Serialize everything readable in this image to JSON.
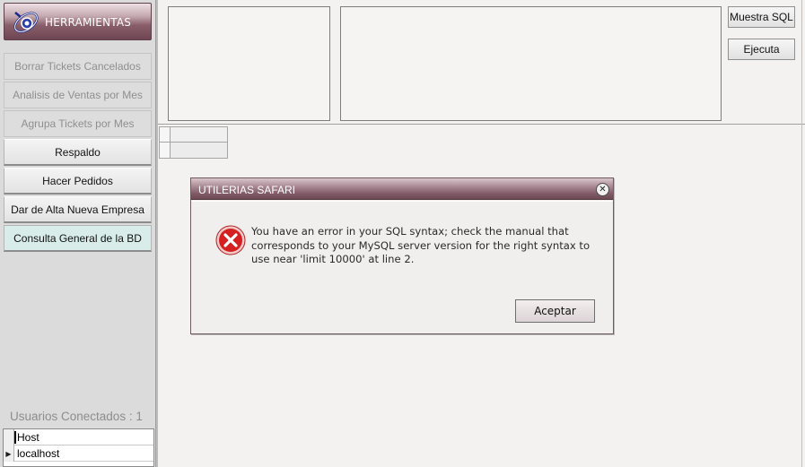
{
  "sidebar": {
    "title": "HERRAMIENTAS",
    "logo_icon": "satellite-logo-icon",
    "items": [
      {
        "label": "Borrar Tickets Cancelados",
        "state": "disabled"
      },
      {
        "label": "Analisis de Ventas por Mes",
        "state": "disabled"
      },
      {
        "label": "Agrupa Tickets por Mes",
        "state": "disabled"
      },
      {
        "label": "Respaldo",
        "state": "enabled"
      },
      {
        "label": "Hacer Pedidos",
        "state": "enabled"
      },
      {
        "label": "Dar de Alta Nueva Empresa",
        "state": "enabled"
      },
      {
        "label": "Consulta General de la BD",
        "state": "selected"
      }
    ],
    "users_label": "Usuarios Conectados : 1",
    "users_grid": {
      "header": "Host",
      "rows": [
        "localhost"
      ]
    }
  },
  "toolbar": {
    "show_sql_label": "Muestra SQL",
    "execute_label": "Ejecuta"
  },
  "dialog": {
    "title": "UTILERIAS SAFARI",
    "close_icon": "close-icon",
    "error_icon": "error-icon",
    "message": "You have an error in your SQL syntax; check the manual that corresponds to your MySQL server version for the right syntax to use near 'limit 10000' at line 2.",
    "ok_label": "Aceptar"
  },
  "colors": {
    "title_bar": "#7f5a66",
    "sidebar_bg": "#dcdbdb",
    "selected_item": "#d8ecea",
    "error_red": "#d42020"
  }
}
